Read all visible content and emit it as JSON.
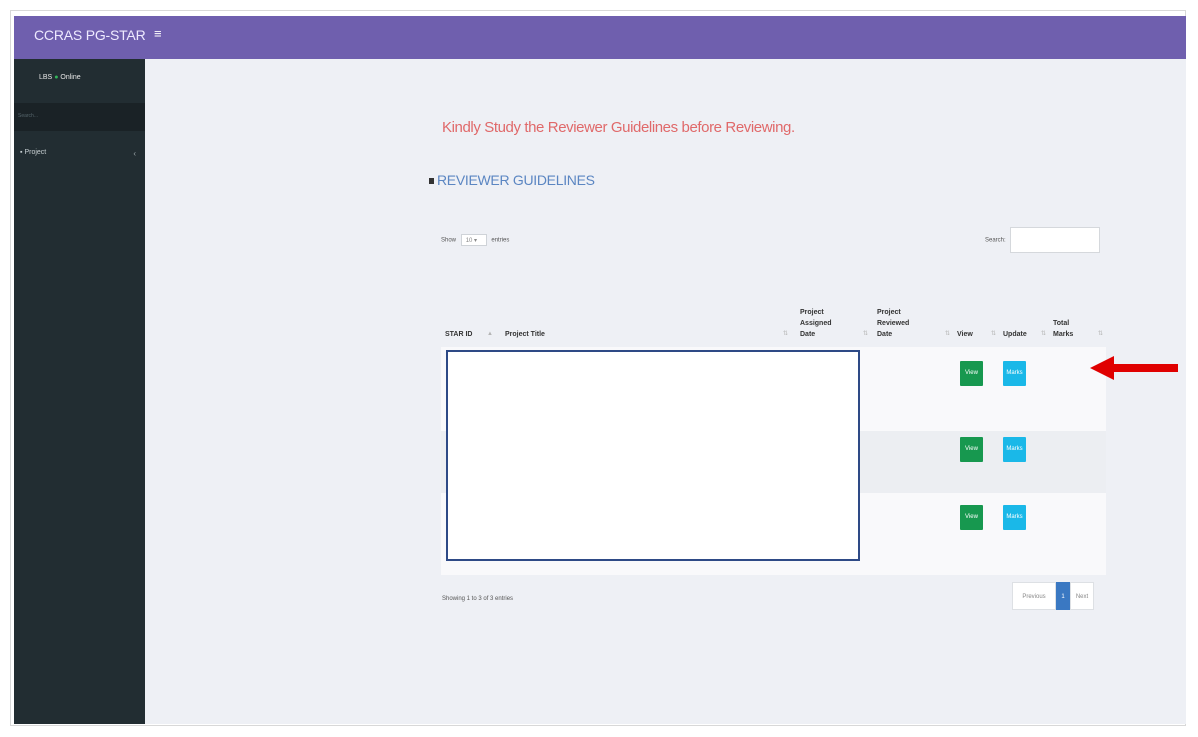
{
  "header": {
    "brand": "CCRAS PG-STAR",
    "menu_icon": "hamburger-icon"
  },
  "sidebar": {
    "user_name": "LBS",
    "status": "Online",
    "search_placeholder": "Search...",
    "items": [
      {
        "label": "Project",
        "icon": "folder-icon"
      }
    ]
  },
  "main": {
    "notice": "Kindly Study the Reviewer Guidelines before Reviewing.",
    "guidelines_link": "REVIEWER GUIDELINES",
    "length": {
      "prefix": "Show",
      "value": "10",
      "suffix": "entries"
    },
    "search_label": "Search:",
    "table": {
      "columns": [
        {
          "line1": "",
          "line2": "",
          "line3": "STAR ID"
        },
        {
          "line1": "",
          "line2": "",
          "line3": "Project Title"
        },
        {
          "line1": "Project",
          "line2": "Assigned",
          "line3": "Date"
        },
        {
          "line1": "Project",
          "line2": "Reviewed",
          "line3": "Date"
        },
        {
          "line1": "",
          "line2": "",
          "line3": "View"
        },
        {
          "line1": "",
          "line2": "",
          "line3": "Update"
        },
        {
          "line1": "",
          "line2": "Total",
          "line3": "Marks"
        }
      ],
      "rows": [
        {
          "view": "View",
          "update": "Marks"
        },
        {
          "view": "View",
          "update": "Marks"
        },
        {
          "view": "View",
          "update": "Marks"
        }
      ]
    },
    "info": "Showing 1 to 3 of 3 entries",
    "pagination": {
      "prev": "Previous",
      "current": "1",
      "next": "Next"
    }
  },
  "colors": {
    "header": "#6f5fae",
    "sidebar": "#222d32",
    "notice": "#e0696a",
    "link": "#5b86c2",
    "view_button": "#17984f",
    "marks_button": "#1ab8e8",
    "annotation_arrow": "#e00000"
  }
}
